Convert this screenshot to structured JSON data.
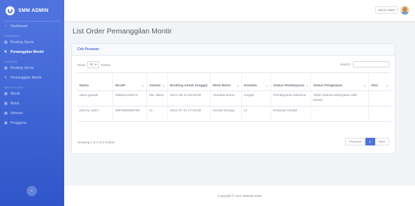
{
  "sidebar": {
    "brand": "SMM ADMIN",
    "items": [
      {
        "type": "link",
        "label": "Dashboard",
        "icon": "tachometer-icon",
        "active": false
      },
      {
        "type": "heading",
        "label": "TRANSAKSI"
      },
      {
        "type": "link",
        "label": "Booking Servis",
        "icon": "table-icon",
        "active": false
      },
      {
        "type": "link",
        "label": "Pemanggilan Montir",
        "icon": "wrench-icon",
        "active": true
      },
      {
        "type": "heading",
        "label": "LAPORAN"
      },
      {
        "type": "link",
        "label": "Booking Servis",
        "icon": "table-icon",
        "active": false
      },
      {
        "type": "link",
        "label": "Pemanggilan Montir",
        "icon": "wrench-icon",
        "active": false
      },
      {
        "type": "heading",
        "label": "MASTER DATA"
      },
      {
        "type": "link",
        "label": "Montir",
        "icon": "table-icon",
        "active": false
      },
      {
        "type": "link",
        "label": "Motor",
        "icon": "table-icon",
        "active": false
      },
      {
        "type": "link",
        "label": "Antrean",
        "icon": "table-icon",
        "active": false
      },
      {
        "type": "link",
        "label": "Pengguna",
        "icon": "table-icon",
        "active": false
      }
    ],
    "toggle_icon": "chevron-left-icon"
  },
  "topbar": {
    "username": "admin SMM"
  },
  "page_title": "List Order Pemanggilan Montir",
  "card": {
    "header": "Cek Pesanan",
    "show_label": "Show",
    "entries_value": "10",
    "entries_label": "entries",
    "search_label": "Search:",
    "columns": [
      "Nama",
      "No.HP",
      "Alamat",
      "Booking Untuk Tanggal",
      "Merk Motor",
      "Kendala",
      "Status Pembayaran",
      "Status Pengerjaan",
      "Aksi"
    ],
    "rows": [
      [
        "danu​ gunadi",
        "085641246574",
        "blo. dams",
        "2021-08-12 08:00:00",
        "Yamaha Nmax",
        "mogok",
        "Pembayaran Diterima",
        "Telah Selesai Dikerjakan oleh Montir",
        "-"
      ],
      [
        "johnny cash r",
        "0867653456788",
        "zz",
        "2021-07-22 17:00:00",
        "Honda Scoopy",
        "zz",
        "Pesanan invalid",
        "-",
        "-"
      ]
    ],
    "info": "Showing 1 to 2 of 2 entries",
    "pagination": {
      "previous": "Previous",
      "current": "1",
      "next": "Next"
    }
  },
  "footer": "Copyright © Your Website 2020",
  "colors": {
    "primary": "#4e73df",
    "background": "#f3f4f7"
  }
}
